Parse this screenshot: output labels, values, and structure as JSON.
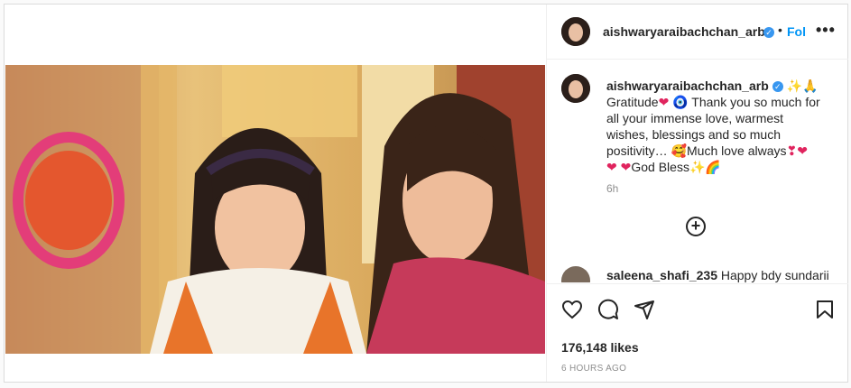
{
  "post": {
    "username": "aishwaryaraibachchan_arb",
    "follow_label": "Follow",
    "more_label": "•••",
    "caption": {
      "username": "aishwaryaraibachchan_arb",
      "line1": "Gratitude",
      "line1b": "Thank you so much for",
      "line2": "all your immense love, warmest",
      "line3": "wishes, blessings and so much",
      "line4": "positivity…",
      "line4b": "Much love always",
      "line5b": "God Bless"
    },
    "caption_time": "6h",
    "comment": {
      "username": "saleena_shafi_235",
      "text": "Happy bdy sundarii"
    },
    "likes": "176,148 likes",
    "posted_ago": "6 HOURS AGO"
  },
  "icons": [
    "heart-icon",
    "comment-icon",
    "share-icon",
    "bookmark-icon",
    "load-more-icon",
    "verified-icon"
  ],
  "colors": {
    "link": "#0095f6",
    "verified": "#3897f0",
    "heart": "#e0245e"
  }
}
